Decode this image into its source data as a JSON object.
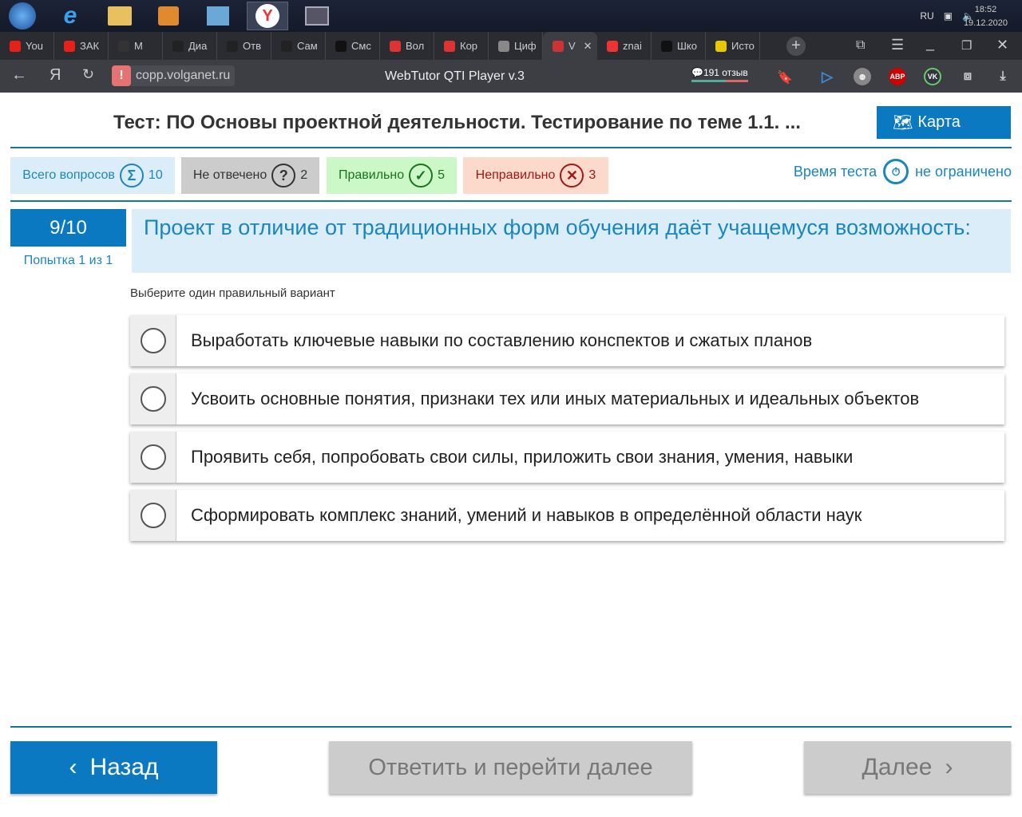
{
  "taskbar": {
    "lang": "RU",
    "time": "18:52",
    "date": "19.12.2020"
  },
  "tabs": [
    {
      "label": "You",
      "color": "#e62117"
    },
    {
      "label": "ЗАК",
      "color": "#e62117"
    },
    {
      "label": "М",
      "color": "#333"
    },
    {
      "label": "Диа",
      "color": "#222"
    },
    {
      "label": "Отв",
      "color": "#222"
    },
    {
      "label": "Сам",
      "color": "#222"
    },
    {
      "label": "Смс",
      "color": "#111"
    },
    {
      "label": "Вол",
      "color": "#d33"
    },
    {
      "label": "Кор",
      "color": "#d33"
    },
    {
      "label": "Циф",
      "color": "#888"
    },
    {
      "label": "V",
      "color": "#c33",
      "active": true
    },
    {
      "label": "znai",
      "color": "#e33"
    },
    {
      "label": "Шко",
      "color": "#111"
    },
    {
      "label": "Исто",
      "color": "#e8c800"
    }
  ],
  "address": {
    "url": "copp.volganet.ru",
    "page_title": "WebTutor QTI Player v.3",
    "reviews": "191 отзыв"
  },
  "header": {
    "title": "Тест: ПО Основы проектной деятельности. Тестирование по теме 1.1. ...",
    "map_label": "Карта"
  },
  "stats": {
    "total_label": "Всего вопросов",
    "total": "10",
    "unanswered_label": "Не отвечено",
    "unanswered": "2",
    "correct_label": "Правильно",
    "correct": "5",
    "wrong_label": "Неправильно",
    "wrong": "3",
    "time_label": "Время теста",
    "time_value": "не ограничено"
  },
  "question": {
    "number": "9/10",
    "attempt": "Попытка 1 из 1",
    "text": "Проект в отличие от традиционных форм обучения даёт учащемуся возможность:",
    "instruction": "Выберите один правильный вариант",
    "options": [
      "Выработать ключевые навыки по составлению конспектов и сжатых планов",
      "Усвоить основные понятия, признаки тех или иных материальных и идеальных объектов",
      "Проявить себя, попробовать свои силы, приложить свои знания, умения, навыки",
      "Сформировать комплекс знаний, умений и навыков в определённой области наук"
    ]
  },
  "footer": {
    "back": "Назад",
    "answer_next": "Ответить и перейти далее",
    "next": "Далее"
  }
}
